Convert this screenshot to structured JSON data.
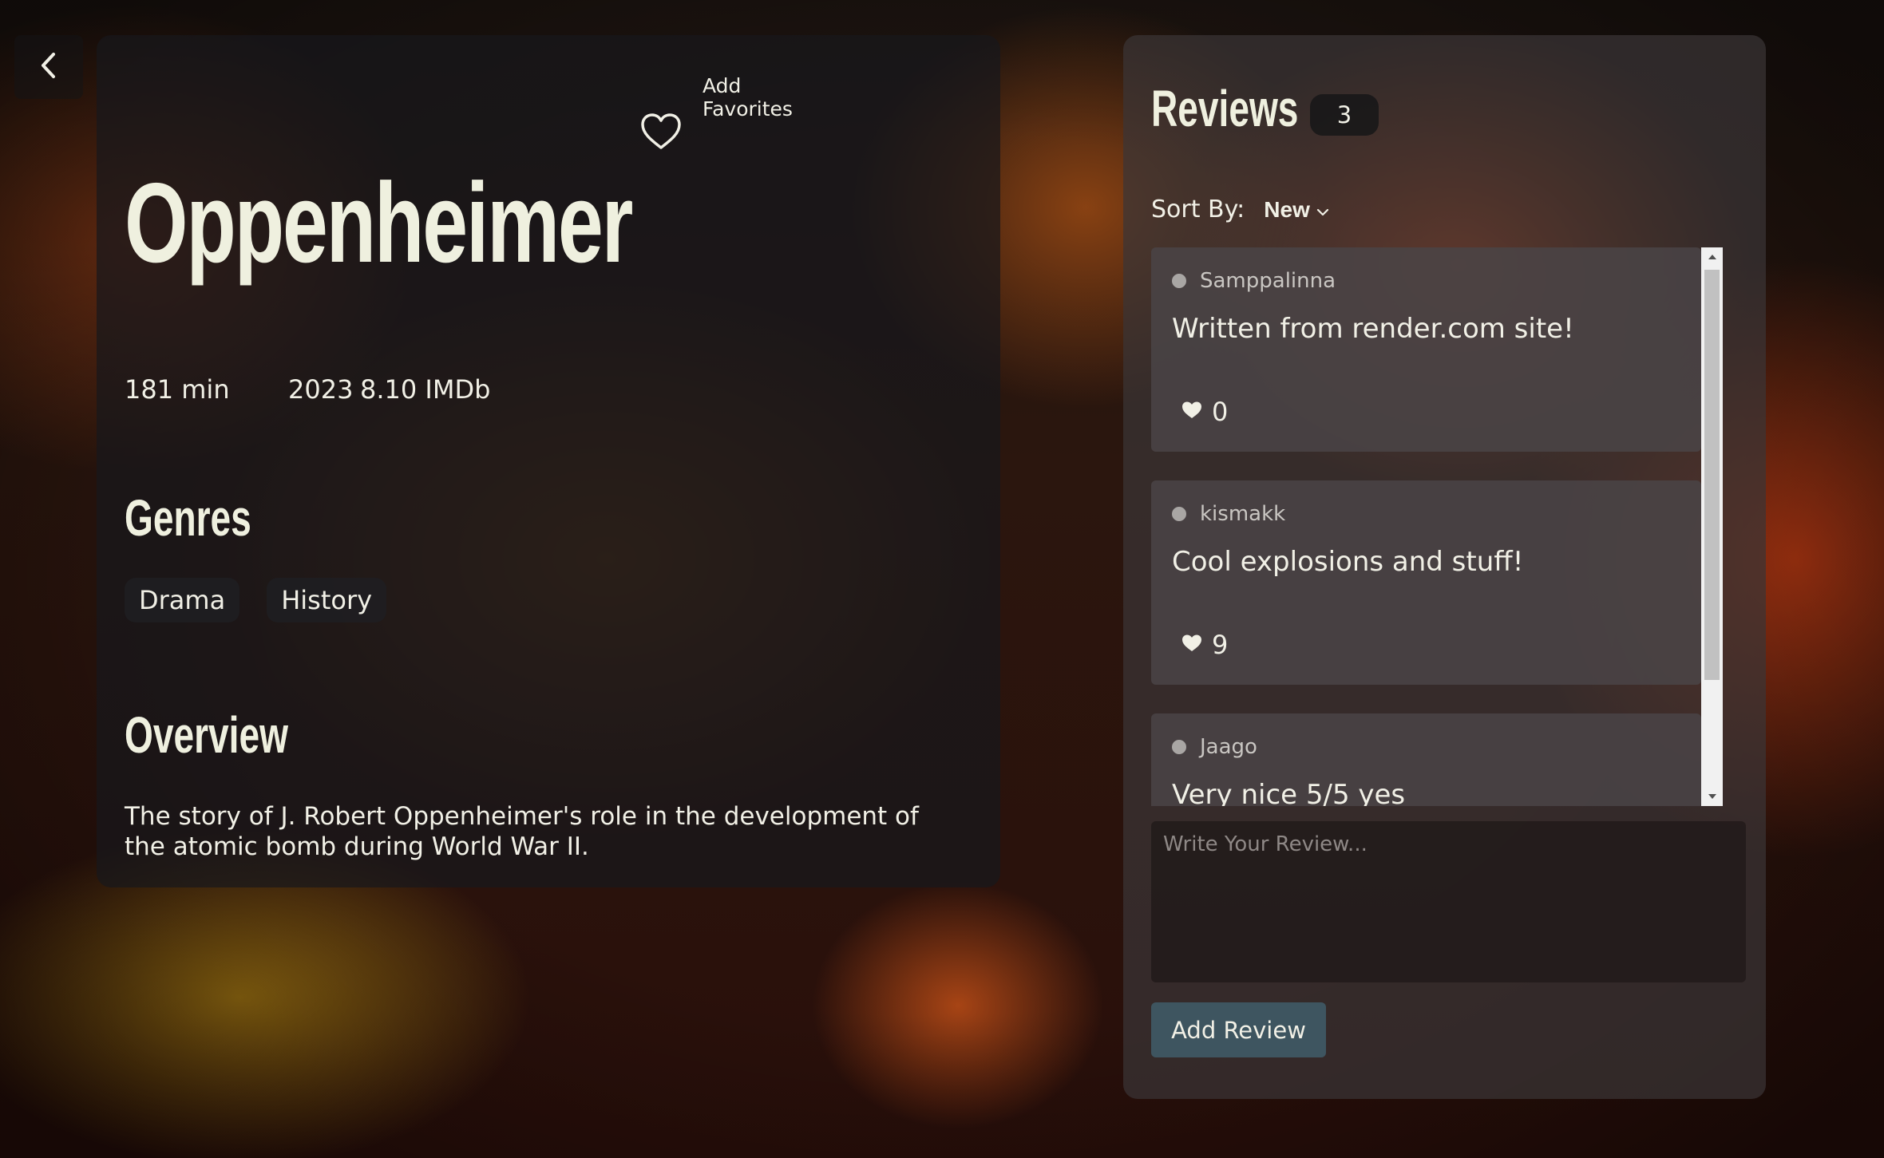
{
  "navigation": {
    "back_icon": "chevron-left-icon"
  },
  "movie": {
    "title": "Oppenheimer",
    "favorite_icon": "heart-outline-icon",
    "favorite_label": "Add Favorites",
    "runtime": "181 min",
    "year": "2023",
    "rating": "8.10 IMDb",
    "genres_heading": "Genres",
    "genres": [
      "Drama",
      "History"
    ],
    "overview_heading": "Overview",
    "overview": "The story of J. Robert Oppenheimer's role in the development of the atomic bomb during World War II."
  },
  "reviews": {
    "heading": "Reviews",
    "count": "3",
    "sort_label": "Sort By:",
    "sort_value": "New",
    "items": [
      {
        "author": "Samppalinna",
        "text": "Written from render.com site!",
        "likes": "0"
      },
      {
        "author": "kismakk",
        "text": "Cool explosions and stuff!",
        "likes": "9"
      },
      {
        "author": "Jaago",
        "text": "Very nice 5/5 yes",
        "likes": ""
      }
    ],
    "input_placeholder": "Write Your Review...",
    "add_button_label": "Add Review"
  },
  "colors": {
    "panel_dark": "#18181c",
    "text_primary": "#f1f0e6",
    "button_bg": "#3e5560",
    "author_muted": "#c9c6c2"
  }
}
